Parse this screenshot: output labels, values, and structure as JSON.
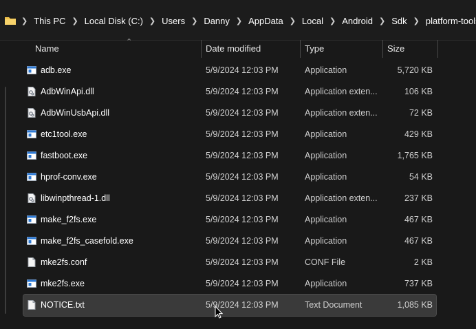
{
  "breadcrumbs": [
    "This PC",
    "Local Disk (C:)",
    "Users",
    "Danny",
    "AppData",
    "Local",
    "Android",
    "Sdk",
    "platform-tools"
  ],
  "columns": {
    "name": "Name",
    "date": "Date modified",
    "type": "Type",
    "size": "Size"
  },
  "files": [
    {
      "name": "adb.exe",
      "date": "5/9/2024 12:03 PM",
      "type": "Application",
      "size": "5,720 KB",
      "icon": "exe"
    },
    {
      "name": "AdbWinApi.dll",
      "date": "5/9/2024 12:03 PM",
      "type": "Application exten...",
      "size": "106 KB",
      "icon": "dll"
    },
    {
      "name": "AdbWinUsbApi.dll",
      "date": "5/9/2024 12:03 PM",
      "type": "Application exten...",
      "size": "72 KB",
      "icon": "dll"
    },
    {
      "name": "etc1tool.exe",
      "date": "5/9/2024 12:03 PM",
      "type": "Application",
      "size": "429 KB",
      "icon": "exe"
    },
    {
      "name": "fastboot.exe",
      "date": "5/9/2024 12:03 PM",
      "type": "Application",
      "size": "1,765 KB",
      "icon": "exe"
    },
    {
      "name": "hprof-conv.exe",
      "date": "5/9/2024 12:03 PM",
      "type": "Application",
      "size": "54 KB",
      "icon": "exe"
    },
    {
      "name": "libwinpthread-1.dll",
      "date": "5/9/2024 12:03 PM",
      "type": "Application exten...",
      "size": "237 KB",
      "icon": "dll"
    },
    {
      "name": "make_f2fs.exe",
      "date": "5/9/2024 12:03 PM",
      "type": "Application",
      "size": "467 KB",
      "icon": "exe"
    },
    {
      "name": "make_f2fs_casefold.exe",
      "date": "5/9/2024 12:03 PM",
      "type": "Application",
      "size": "467 KB",
      "icon": "exe"
    },
    {
      "name": "mke2fs.conf",
      "date": "5/9/2024 12:03 PM",
      "type": "CONF File",
      "size": "2 KB",
      "icon": "file"
    },
    {
      "name": "mke2fs.exe",
      "date": "5/9/2024 12:03 PM",
      "type": "Application",
      "size": "737 KB",
      "icon": "exe"
    },
    {
      "name": "NOTICE.txt",
      "date": "5/9/2024 12:03 PM",
      "type": "Text Document",
      "size": "1,085 KB",
      "icon": "file",
      "selected": true
    }
  ],
  "colors": {
    "background": "#191919",
    "selected_row": "#3a3a3a",
    "exe_icon_blue": "#2f7bd6",
    "folder_yellow": "#f0c24b"
  }
}
